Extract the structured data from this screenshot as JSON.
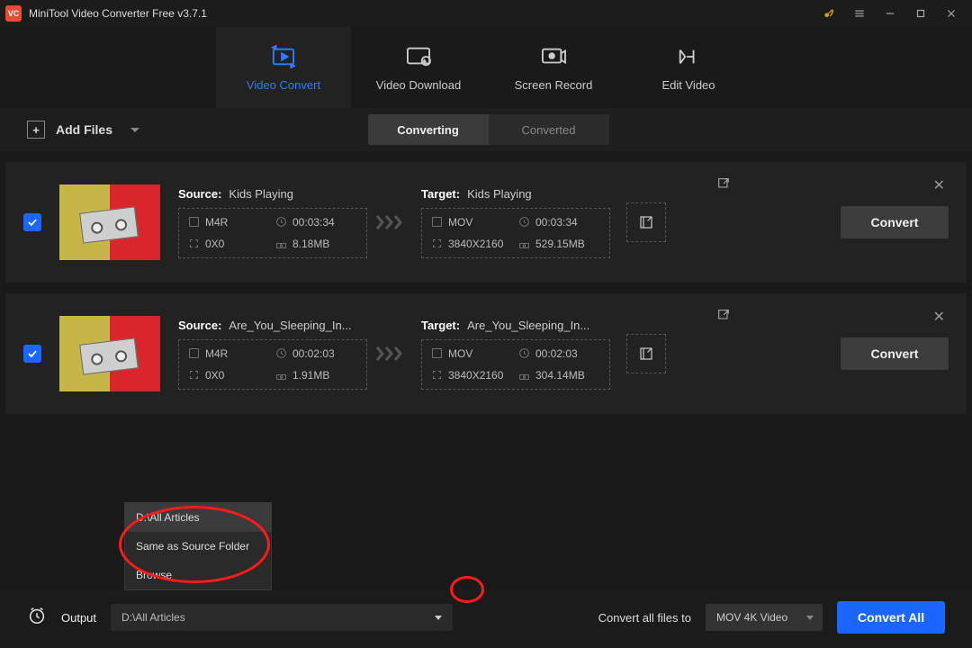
{
  "title": "MiniTool Video Converter Free v3.7.1",
  "tabs": [
    {
      "label": "Video Convert"
    },
    {
      "label": "Video Download"
    },
    {
      "label": "Screen Record"
    },
    {
      "label": "Edit Video"
    }
  ],
  "add_label": "Add Files",
  "segments": [
    {
      "label": "Converting"
    },
    {
      "label": "Converted"
    }
  ],
  "source_word": "Source:",
  "target_word": "Target:",
  "rows": [
    {
      "source_name": "Kids Playing",
      "target_name": "Kids Playing",
      "src": {
        "fmt": "M4R",
        "dur": "00:03:34",
        "res": "0X0",
        "size": "8.18MB"
      },
      "tgt": {
        "fmt": "MOV",
        "dur": "00:03:34",
        "res": "3840X2160",
        "size": "529.15MB"
      },
      "convert": "Convert"
    },
    {
      "source_name": "Are_You_Sleeping_In...",
      "target_name": "Are_You_Sleeping_In...",
      "src": {
        "fmt": "M4R",
        "dur": "00:02:03",
        "res": "0X0",
        "size": "1.91MB"
      },
      "tgt": {
        "fmt": "MOV",
        "dur": "00:02:03",
        "res": "3840X2160",
        "size": "304.14MB"
      },
      "convert": "Convert"
    }
  ],
  "popup_items": [
    "D:\\All Articles",
    "Same as Source Folder",
    "Browse"
  ],
  "output_label": "Output",
  "output_value": "D:\\All Articles",
  "format_label": "Convert all files to",
  "format_value": "MOV 4K Video",
  "convert_all": "Convert All"
}
